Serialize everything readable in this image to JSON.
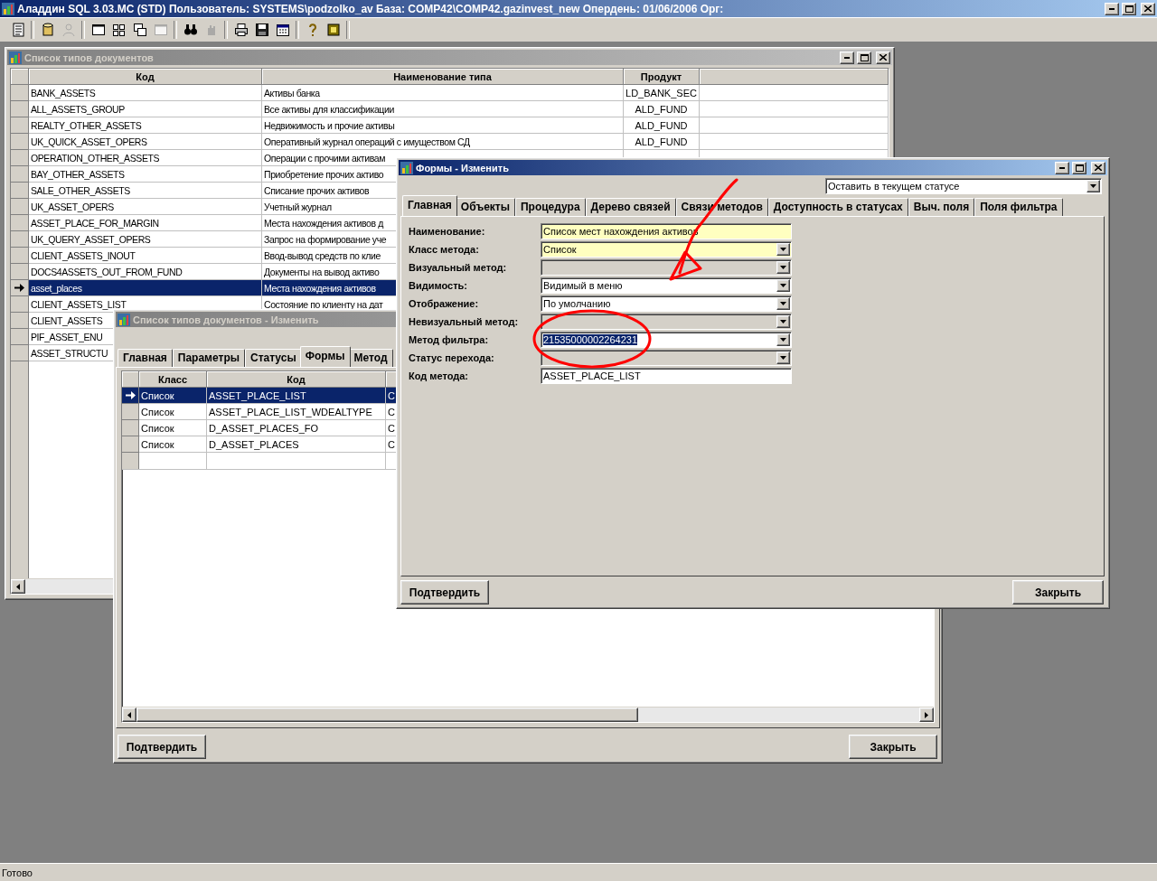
{
  "app": {
    "title": "Аладдин SQL 3.03.MC (STD)  Пользователь: SYSTEMS\\podzolko_av База: COMP42\\COMP42.gazinvest_new Опердень: 01/06/2006 Орг:"
  },
  "toolbar": [
    {
      "kind": "list",
      "disabled": false
    },
    {
      "kind": "database",
      "disabled": false
    },
    {
      "kind": "person",
      "disabled": true
    },
    {
      "kind": "window",
      "disabled": false
    },
    {
      "kind": "tile",
      "disabled": false
    },
    {
      "kind": "cascade",
      "disabled": false
    },
    {
      "kind": "window",
      "disabled": true
    },
    {
      "kind": "binoculars",
      "disabled": false
    },
    {
      "kind": "stop",
      "disabled": true
    },
    {
      "kind": "printer",
      "disabled": false
    },
    {
      "kind": "floppy",
      "disabled": false
    },
    {
      "kind": "calendar",
      "disabled": false
    },
    {
      "kind": "help",
      "disabled": false
    },
    {
      "kind": "exit",
      "disabled": false
    }
  ],
  "doc_types_window": {
    "title": "Список типов документов",
    "active": false,
    "columns": [
      "Код",
      "Наименование типа",
      "Продукт"
    ],
    "rows": [
      {
        "code": "BANK_ASSETS",
        "name": "Активы банка",
        "product": "LD_BANK_SEC",
        "selected": false
      },
      {
        "code": "ALL_ASSETS_GROUP",
        "name": "Все активы для классификации",
        "product": "ALD_FUND",
        "selected": false
      },
      {
        "code": "REALTY_OTHER_ASSETS",
        "name": "Недвижимость и прочие активы",
        "product": "ALD_FUND",
        "selected": false
      },
      {
        "code": "UK_QUICK_ASSET_OPERS",
        "name": "Оперативный журнал операций с имуществом СД",
        "product": "ALD_FUND",
        "selected": false
      },
      {
        "code": "OPERATION_OTHER_ASSETS",
        "name": "Операции с прочими активам",
        "selected": false
      },
      {
        "code": "BAY_OTHER_ASSETS",
        "name": "Приобретение прочих активо",
        "selected": false
      },
      {
        "code": "SALE_OTHER_ASSETS",
        "name": "Списание прочих активов",
        "selected": false
      },
      {
        "code": "UK_ASSET_OPERS",
        "name": "Учетный журнал",
        "selected": false
      },
      {
        "code": "ASSET_PLACE_FOR_MARGIN",
        "name": "Места нахождения активов д",
        "selected": false
      },
      {
        "code": "UK_QUERY_ASSET_OPERS",
        "name": "Запрос на формирование уче",
        "selected": false
      },
      {
        "code": "CLIENT_ASSETS_INOUT",
        "name": "Ввод-вывод средств по клие",
        "selected": false
      },
      {
        "code": "DOCS4ASSETS_OUT_FROM_FUND",
        "name": "Документы на вывод активо",
        "selected": false
      },
      {
        "code": "asset_places",
        "name": "Места нахождения активов",
        "selected": true
      },
      {
        "code": "CLIENT_ASSETS_LIST",
        "name": "Состояние по клиенту на дат",
        "selected": false
      },
      {
        "code": "CLIENT_ASSETS",
        "selected": false
      },
      {
        "code": "PIF_ASSET_ENU",
        "selected": false
      },
      {
        "code": "ASSET_STRUCTU",
        "selected": false
      }
    ]
  },
  "doc_type_edit_window": {
    "title": "Список типов документов - Изменить",
    "active": false,
    "tabs": [
      {
        "label": "Главная",
        "selected": false
      },
      {
        "label": "Параметры",
        "selected": false
      },
      {
        "label": "Статусы",
        "selected": false
      },
      {
        "label": "Формы",
        "selected": true
      },
      {
        "label": "Метод",
        "selected": false
      }
    ],
    "columns": [
      "Класс",
      "Код"
    ],
    "rows": [
      {
        "class": "Список",
        "code": "ASSET_PLACE_LIST",
        "column_3": "С",
        "selected": true
      },
      {
        "class": "Список",
        "code": "ASSET_PLACE_LIST_WDEALTYPE",
        "column_3": "С",
        "selected": false
      },
      {
        "class": "Список",
        "code": "D_ASSET_PLACES_FO",
        "column_3": "С",
        "selected": false
      },
      {
        "class": "Список",
        "code": "D_ASSET_PLACES",
        "column_3": "С",
        "selected": false
      }
    ],
    "buttons": [
      "Подтвердить",
      "Закрыть"
    ]
  },
  "form_edit_window": {
    "title": "Формы - Изменить",
    "active": true,
    "status_select": "Оставить в текущем статусе",
    "tabs": [
      {
        "label": "Главная",
        "selected": true
      },
      {
        "label": "Объекты",
        "selected": false
      },
      {
        "label": "Процедура",
        "selected": false
      },
      {
        "label": "Дерево связей",
        "selected": false
      },
      {
        "label": "Связи методов",
        "selected": false
      },
      {
        "label": "Доступность в статусах",
        "selected": false
      },
      {
        "label": "Выч. поля",
        "selected": false
      },
      {
        "label": "Поля фильтра",
        "selected": false
      }
    ],
    "fields": [
      {
        "label": "Наименование:",
        "kind": "text",
        "value": "Список мест нахождения активов",
        "required": true,
        "disabled": false
      },
      {
        "label": "Класс метода:",
        "kind": "combo",
        "value": "Список",
        "required": true,
        "disabled": false
      },
      {
        "label": "Визуальный метод:",
        "kind": "combo",
        "required": false,
        "disabled": true
      },
      {
        "label": "Видимость:",
        "kind": "combo",
        "value": "Видимый в меню",
        "required": false,
        "disabled": false
      },
      {
        "label": "Отображение:",
        "kind": "combo",
        "value": "По умолчанию",
        "required": false,
        "disabled": false
      },
      {
        "label": "Невизуальный метод:",
        "kind": "combo",
        "required": false,
        "disabled": true
      },
      {
        "label": "Метод фильтра:",
        "kind": "combo",
        "value": "21535000002264231",
        "required": false,
        "disabled": false,
        "text_selected": true
      },
      {
        "label": "Статус перехода:",
        "kind": "combo",
        "required": false,
        "disabled": true
      },
      {
        "label": "Код метода:",
        "kind": "text",
        "value": "ASSET_PLACE_LIST",
        "required": false,
        "disabled": false
      }
    ],
    "buttons": [
      "Подтвердить",
      "Закрыть"
    ]
  },
  "status_bar": "Готово"
}
